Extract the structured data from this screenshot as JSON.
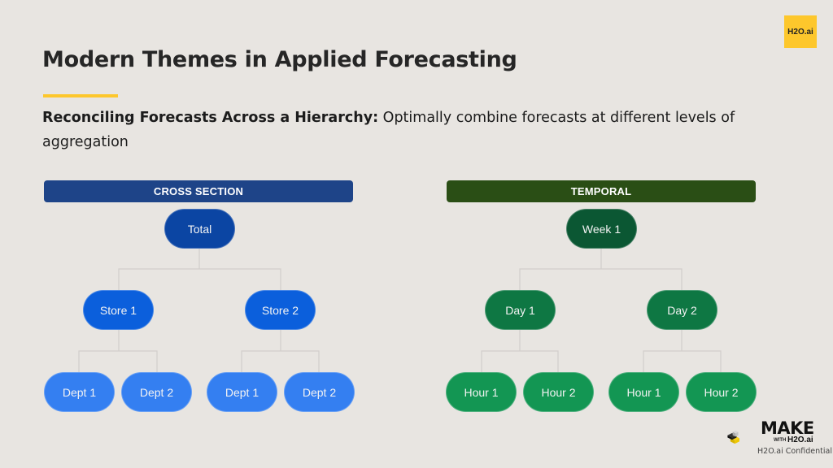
{
  "slide": {
    "title": "Modern Themes in Applied Forecasting",
    "subtitle_bold": "Reconciling Forecasts Across a Hierarchy:",
    "subtitle_rest": " Optimally combine forecasts at different levels of aggregation",
    "accent_color": "#fdc72c"
  },
  "logos": {
    "top_right": "H2O.ai",
    "make_title": "MAKE",
    "make_with": "WITH",
    "make_brand": "H2O.ai",
    "confidential": "H2O.ai Confidential"
  },
  "diagrams": {
    "cross_section": {
      "header": "CROSS SECTION",
      "header_color": "#1e4488",
      "root": "Total",
      "level1": [
        "Store 1",
        "Store 2"
      ],
      "level2": [
        "Dept 1",
        "Dept 2",
        "Dept 1",
        "Dept 2"
      ],
      "colors": {
        "root": "#0b45a3",
        "level1": "#0b5fdc",
        "level2": "#347ff1"
      }
    },
    "temporal": {
      "header": "TEMPORAL",
      "header_color": "#2a4e15",
      "root": "Week 1",
      "level1": [
        "Day 1",
        "Day 2"
      ],
      "level2": [
        "Hour 1",
        "Hour 2",
        "Hour 1",
        "Hour 2"
      ],
      "colors": {
        "root": "#0b5733",
        "level1": "#0e7743",
        "level2": "#139653"
      }
    }
  }
}
